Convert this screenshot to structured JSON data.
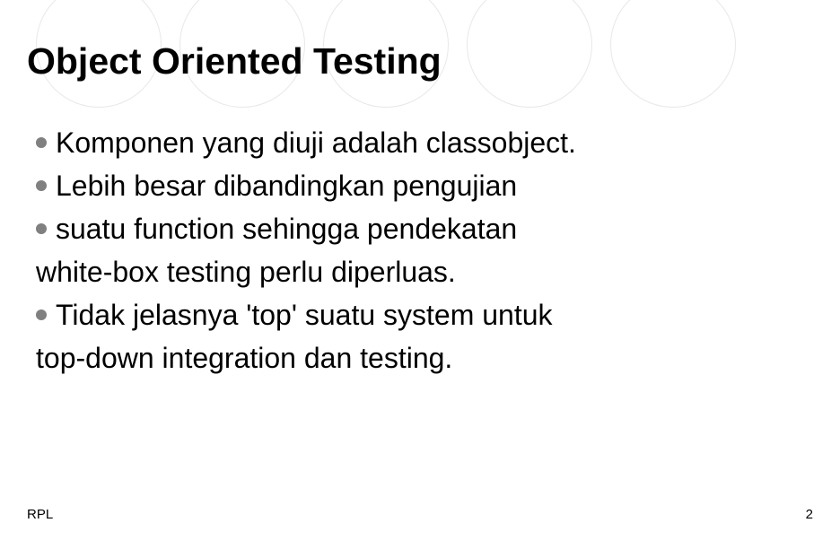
{
  "title": "Object Oriented Testing",
  "bullets": {
    "b1": "Komponen yang diuji adalah classobject.",
    "b2": "Lebih besar dibandingkan pengujian",
    "b3": "suatu function sehingga pendekatan",
    "b3_cont": "white-box testing perlu diperluas.",
    "b4": "Tidak jelasnya 'top' suatu system untuk",
    "b4_cont": "top-down integration dan testing."
  },
  "footer": {
    "left": "RPL",
    "right": "2"
  }
}
